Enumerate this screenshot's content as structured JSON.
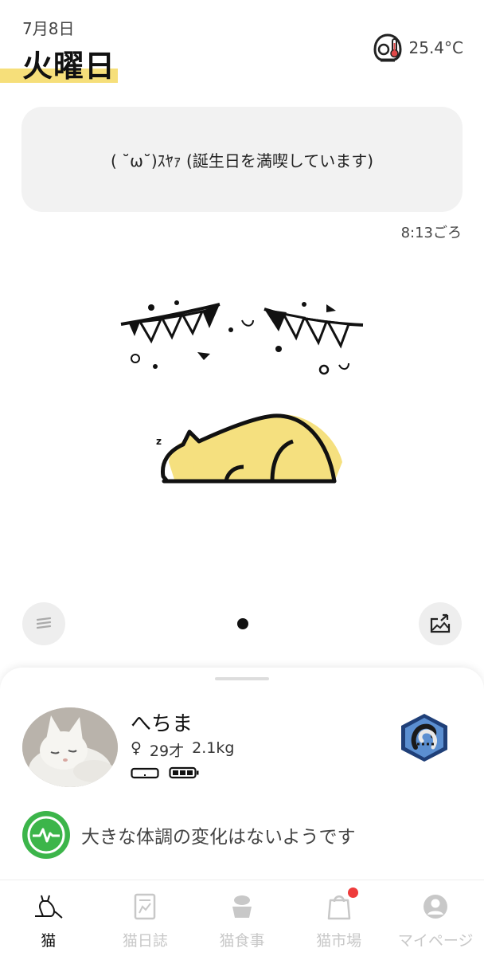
{
  "header": {
    "date": "7月8日",
    "day_of_week": "火曜日",
    "temperature": "25.4°C",
    "temperature_icon": "thermo-device-icon"
  },
  "message": {
    "text": "( ˘ω˘)ｽﾔｧ (誕生日を満喫しています)",
    "time": "8:13ごろ"
  },
  "scene": {
    "cat_state": "sleeping",
    "cat_color": "#f5e07f",
    "bunting_color": "#111111"
  },
  "controls": {
    "left_icon": "menu-lines-icon",
    "right_icon": "share-image-icon",
    "page_indicator_count": 1
  },
  "cat": {
    "name": "へちま",
    "sex_symbol": "♀",
    "age": "29才",
    "weight": "2.1kg",
    "devices": [
      "tray-device-icon",
      "battery-full-icon"
    ],
    "badge_icon": "cat-hexagon-badge-icon"
  },
  "health": {
    "icon": "heartbeat-icon",
    "color": "#3cb54a",
    "text": "大きな体調の変化はないようです"
  },
  "nav": {
    "items": [
      {
        "label": "猫",
        "icon": "cat-icon",
        "active": true
      },
      {
        "label": "猫日誌",
        "icon": "diary-icon",
        "active": false
      },
      {
        "label": "猫食事",
        "icon": "food-bowl-icon",
        "active": false
      },
      {
        "label": "猫市場",
        "icon": "shopping-bag-icon",
        "active": false,
        "notification": true
      },
      {
        "label": "マイページ",
        "icon": "profile-icon",
        "active": false
      }
    ]
  }
}
